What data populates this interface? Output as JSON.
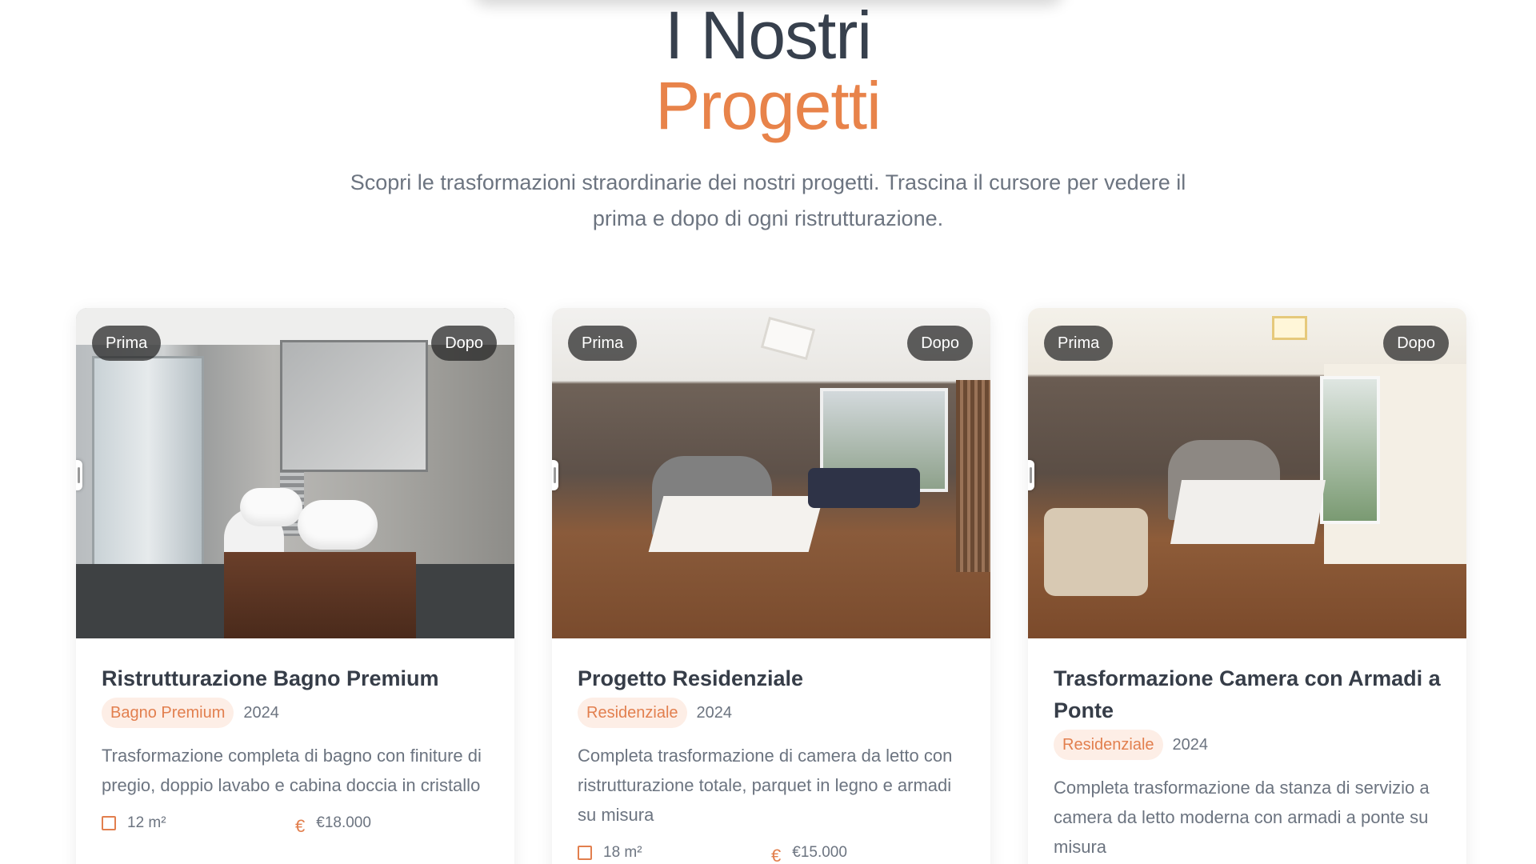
{
  "hero": {
    "title_line1": "I Nostri",
    "title_line2": "Progetti",
    "subtitle": "Scopri le trasformazioni straordinarie dei nostri progetti. Trascina il cursore per vedere il prima e dopo di ogni ristrutturazione."
  },
  "colors": {
    "accent": "#e8834a",
    "title": "#37404d",
    "muted": "#6c7480",
    "tag_bg": "#fdeee6"
  },
  "labels": {
    "before": "Prima",
    "after": "Dopo"
  },
  "projects": [
    {
      "title": "Ristrutturazione Bagno Premium",
      "category": "Bagno Premium",
      "year": "2024",
      "description": "Trasformazione completa di bagno con finiture di pregio, doppio lavabo e cabina doccia in cristallo",
      "area": "12 m²",
      "price": "€18.000"
    },
    {
      "title": "Progetto Residenziale",
      "category": "Residenziale",
      "year": "2024",
      "description": "Completa trasformazione di camera da letto con ristrutturazione totale, parquet in legno e armadi su misura",
      "area": "18 m²",
      "price": "€15.000"
    },
    {
      "title": "Trasformazione Camera con Armadi a Ponte",
      "category": "Residenziale",
      "year": "2024",
      "description": "Completa trasformazione da stanza di servizio a camera da letto moderna con armadi a ponte su misura",
      "area": "",
      "price": ""
    }
  ],
  "icons": {
    "area": "floor-plan-icon",
    "price": "euro-icon"
  }
}
